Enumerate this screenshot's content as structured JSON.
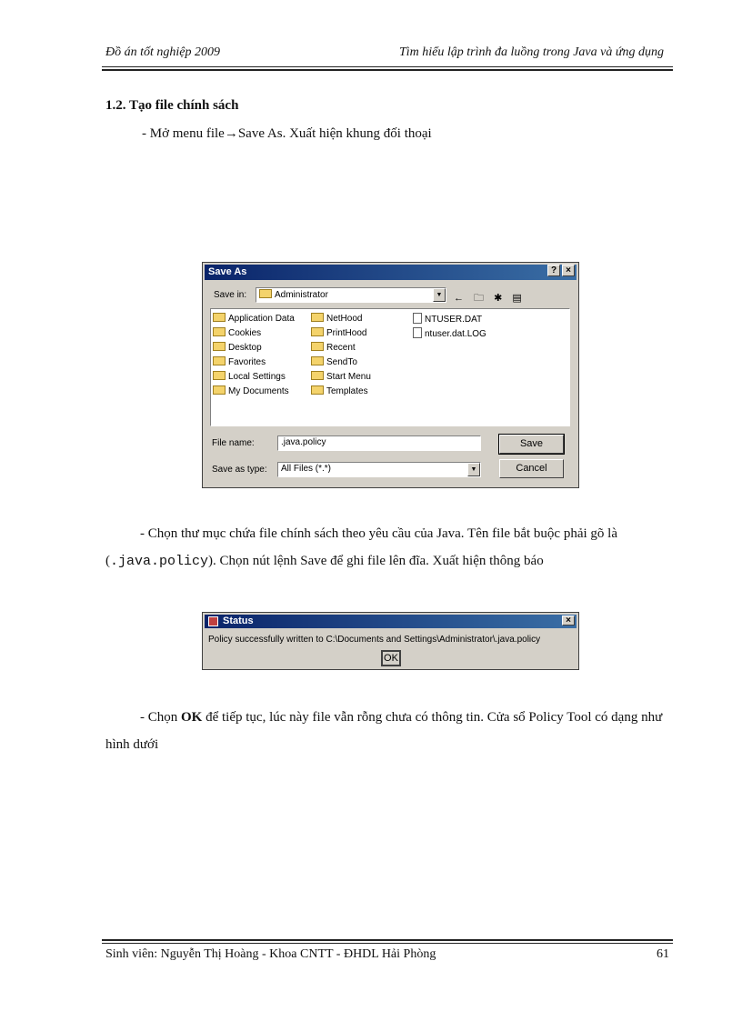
{
  "header": {
    "left": "Đồ án tốt nghiệp  2009",
    "right": "Tìm  hiểu lập trình  đa luồng  trong Java và ứng  dụng"
  },
  "section_title": "1.2. Tạo file chính sách",
  "para1": "- Mở menu file→Save As. Xuất hiện khung  đối thoại",
  "save_dialog": {
    "title": "Save As",
    "help_label": "?",
    "close_label": "×",
    "save_in_label": "Save in:",
    "save_in_value": "Administrator",
    "toolbar_icons": "← 🗀 ✱ ▤",
    "folders_col1": [
      "Application Data",
      "Cookies",
      "Desktop",
      "Favorites",
      "Local Settings",
      "My Documents"
    ],
    "folders_col2": [
      "NetHood",
      "PrintHood",
      "Recent",
      "SendTo",
      "Start Menu",
      "Templates"
    ],
    "files_col3": [
      "NTUSER.DAT",
      "ntuser.dat.LOG"
    ],
    "file_name_label": "File name:",
    "file_name_value": ".java.policy",
    "save_as_type_label": "Save as type:",
    "save_as_type_value": "All Files (*.*)",
    "save_button": "Save",
    "cancel_button": "Cancel"
  },
  "para2": {
    "a": "- Chọn thư mục chứa file chính sách theo yêu cầu của Java.  Tên file bắt buộc phải  gõ là (",
    "code": ".java.policy",
    "b": "). Chọn nút lệnh Save để ghi file lên đĩa. Xuất hiện thông báo"
  },
  "status_dialog": {
    "title": "Status",
    "close_label": "×",
    "message": "Policy successfully written to C:\\Documents and Settings\\Administrator\\.java.policy",
    "ok_button": "OK"
  },
  "para3": {
    "a": "- Chọn ",
    "bold": "OK",
    "b": " để tiếp tục, lúc này file vẫn  rỗng chưa có thông tin. Cửa sổ Policy Tool có dạng như hình dưới"
  },
  "footer": {
    "left": "Sinh  viên:  Nguyễn  Thị  Hoàng  - Khoa CNTT - ĐHDL  Hải  Phòng",
    "page": "61"
  }
}
